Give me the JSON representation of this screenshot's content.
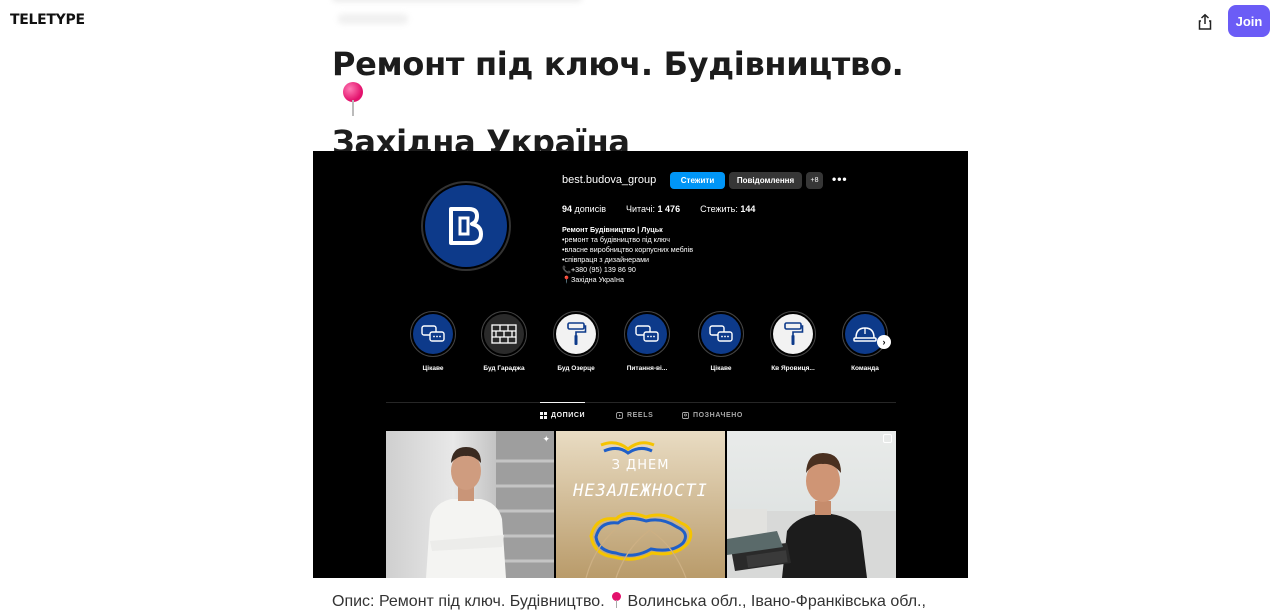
{
  "header": {
    "logo": "TELETYPE",
    "join_label": "Join",
    "share_icon": "share-icon"
  },
  "article": {
    "title": "Ремонт під ключ. Будівництво. Західна Україна",
    "title_line1": "Ремонт під ключ. Будівництво.",
    "title_line2": "Західна Україна",
    "title_emoji": "round-pushpin-icon",
    "caption_part1": "Опис: Ремонт під ключ. Будівництво.",
    "caption_part2": "Волинська обл., Івано-Франківська обл.,"
  },
  "profile": {
    "username": "best.budova_group",
    "follow_label": "Стежити",
    "message_label": "Повідомлення",
    "posts_count": "94",
    "posts_label": "дописів",
    "followers_label": "Читачі:",
    "followers_count": "1 476",
    "following_label": "Стежить:",
    "following_count": "144",
    "bio_name": "Ремонт Будівництво | Луцьк",
    "bio_lines": [
      "•ремонт та будівництво під ключ",
      "•власне виробництво корпусних меблів",
      "•співпраця з дизайнерами",
      "📞+380 (95) 139 86 90",
      "📍Західна Україна"
    ],
    "highlights": [
      {
        "label": "Цікаве",
        "icon": "chat-bubbles-icon",
        "bg": "#0d3a8a"
      },
      {
        "label": "Буд Гараджа",
        "icon": "brick-wall-icon",
        "bg": "#2a2a2a"
      },
      {
        "label": "Буд Озерце",
        "icon": "paint-roller-icon",
        "bg": "#f2f2f2"
      },
      {
        "label": "Питання-ві...",
        "icon": "chat-bubbles-icon",
        "bg": "#0d3a8a"
      },
      {
        "label": "Цікаве",
        "icon": "chat-bubbles-icon",
        "bg": "#0d3a8a"
      },
      {
        "label": "Кв Яровиця...",
        "icon": "paint-roller-icon",
        "bg": "#f2f2f2"
      },
      {
        "label": "Команда",
        "icon": "hard-hat-icon",
        "bg": "#0d3a8a"
      }
    ],
    "tabs": [
      {
        "label": "ДОПИСИ",
        "active": true
      },
      {
        "label": "REELS",
        "active": false
      },
      {
        "label": "ПОЗНАЧЕНО",
        "active": false
      }
    ],
    "post2_text_top": "З ДНЕМ",
    "post2_text_main": "НЕЗАЛЕЖНОСТІ"
  },
  "colors": {
    "join_button": "#6b5cf6",
    "follow_button": "#0095f6",
    "brand_blue": "#0d3a8a",
    "pin_pink": "#e3116c"
  }
}
